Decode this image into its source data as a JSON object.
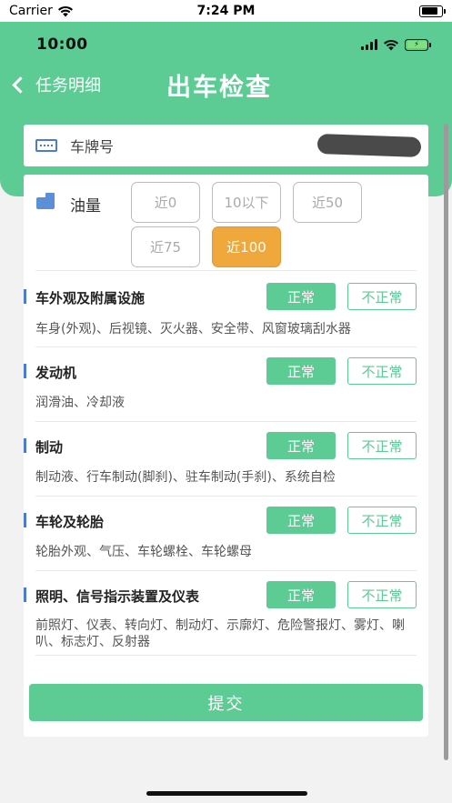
{
  "ios_status": {
    "carrier": "Carrier",
    "time": "7:24 PM",
    "wifi_icon": "wifi-icon",
    "battery_icon": "battery-icon"
  },
  "app_status": {
    "time": "10:00",
    "charging_symbol": "⚡"
  },
  "nav": {
    "back_label": "任务明细",
    "title": "出车检查"
  },
  "plate": {
    "label": "车牌号",
    "value_redacted": true
  },
  "oil": {
    "label": "油量",
    "options": [
      "近0",
      "10以下",
      "近50",
      "近75",
      "近100"
    ],
    "selected": "近100"
  },
  "sections": [
    {
      "title": "车外观及附属设施",
      "ok_label": "正常",
      "bad_label": "不正常",
      "desc": "车身(外观)、后视镜、灭火器、安全带、风窗玻璃刮水器"
    },
    {
      "title": "发动机",
      "ok_label": "正常",
      "bad_label": "不正常",
      "desc": "润滑油、冷却液"
    },
    {
      "title": "制动",
      "ok_label": "正常",
      "bad_label": "不正常",
      "desc": "制动液、行车制动(脚刹)、驻车制动(手刹)、系统自检"
    },
    {
      "title": "车轮及轮胎",
      "ok_label": "正常",
      "bad_label": "不正常",
      "desc": "轮胎外观、气压、车轮螺栓、车轮螺母"
    },
    {
      "title": "照明、信号指示装置及仪表",
      "ok_label": "正常",
      "bad_label": "不正常",
      "desc": "前照灯、仪表、转向灯、制动灯、示廓灯、危险警报灯、雾灯、喇叭、标志灯、反射器"
    }
  ],
  "submit_label": "提交",
  "colors": {
    "primary": "#5ccb94",
    "selected": "#f0a83d",
    "accent_bar": "#4a7bd8"
  }
}
